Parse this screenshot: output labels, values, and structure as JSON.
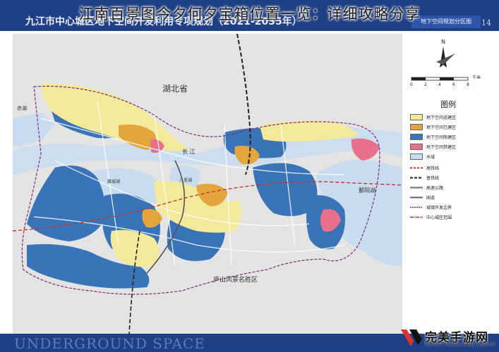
{
  "overlay_title": "江南百景图今夕何夕宝箱位置一览：详细攻略分享",
  "header": {
    "subtitle": "九江市中心城区地下空间开发利用专项规划（2021-2035年）",
    "right_label": "地下空间规划分区图",
    "page_number": "14"
  },
  "map": {
    "labels": {
      "hubei": "湖北省",
      "chibi": "赤湖",
      "changjiang": "长 江",
      "poyang": "鄱阳湖",
      "saicheng": "赛城湖",
      "balihu": "八里湖",
      "lushan": "庐山风景名胜区"
    },
    "colors": {
      "background": "#e3e3e3",
      "water": "#c9dcef",
      "yellow_zone": "#f2ea9a",
      "orange_zone": "#e3a53c",
      "blue_zone": "#3a74b8",
      "pink_zone": "#e8708a",
      "road": "#ffffff",
      "boundary": "#7b2b7a"
    }
  },
  "compass": {
    "north": "N",
    "scale_unit": "千米",
    "scale_ticks": [
      "0",
      "2",
      "4",
      "6",
      "8"
    ]
  },
  "legend": {
    "title": "图例",
    "items": [
      {
        "label": "地下空间适建区",
        "color": "#f2ea9a",
        "kind": "swatch"
      },
      {
        "label": "地下空间已建区",
        "color": "#e3a53c",
        "kind": "swatch"
      },
      {
        "label": "地下空间限建区",
        "color": "#3a74b8",
        "kind": "swatch"
      },
      {
        "label": "地下空间禁建区",
        "color": "#e8708a",
        "kind": "swatch"
      },
      {
        "label": "水域",
        "color": "#c9dcef",
        "kind": "swatch"
      },
      {
        "label": "高铁线",
        "color": "#c0392b",
        "kind": "line"
      },
      {
        "label": "普铁线",
        "color": "#222222",
        "kind": "line"
      },
      {
        "label": "高速公路",
        "color": "#888888",
        "kind": "line"
      },
      {
        "label": "国道",
        "color": "#6b4fa0",
        "kind": "line"
      },
      {
        "label": "城镇开发边界",
        "color": "#7b2b7a",
        "kind": "line"
      },
      {
        "label": "中心城区范围",
        "color": "#b03030",
        "kind": "line"
      }
    ]
  },
  "footer": {
    "english": "UNDERGROUND SPACE"
  },
  "watermark": {
    "brand": "完美手游网",
    "tagline": "PERFECT MOBILE GAME WEBSITE"
  }
}
